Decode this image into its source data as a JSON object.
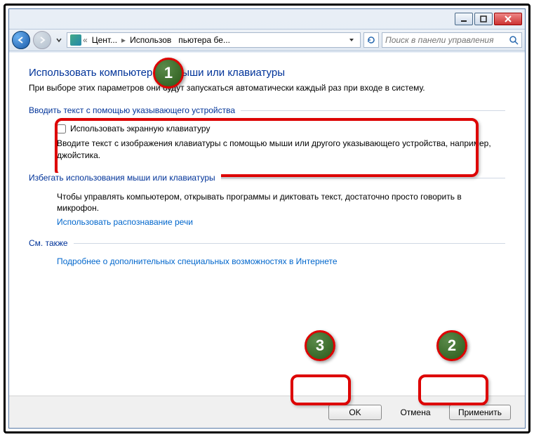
{
  "breadcrumb": {
    "item1": "Цент...",
    "item2": "Использов",
    "item3": "пьютера бе..."
  },
  "search": {
    "placeholder": "Поиск в панели управления"
  },
  "page": {
    "title": "Использовать компьютер без мыши или клавиатуры",
    "subtitle": "При выборе этих параметров они будут запускаться автоматически каждый раз при входе в систему."
  },
  "group1": {
    "legend": "Вводить текст с помощью указывающего устройства",
    "checkbox": "Использовать экранную клавиатуру",
    "help": "Вводите текст с изображения клавиатуры с помощью мыши или другого указывающего устройства, например, джойстика."
  },
  "group2": {
    "legend": "Избегать использования мыши или клавиатуры",
    "help": "Чтобы управлять компьютером, открывать программы и диктовать текст, достаточно просто говорить в микрофон.",
    "link": "Использовать распознавание речи"
  },
  "group3": {
    "legend": "См. также",
    "link": "Подробнее о дополнительных специальных возможностях в Интернете"
  },
  "buttons": {
    "ok": "OK",
    "cancel": "Отмена",
    "apply": "Применить"
  },
  "callouts": {
    "n1": "1",
    "n2": "2",
    "n3": "3"
  }
}
